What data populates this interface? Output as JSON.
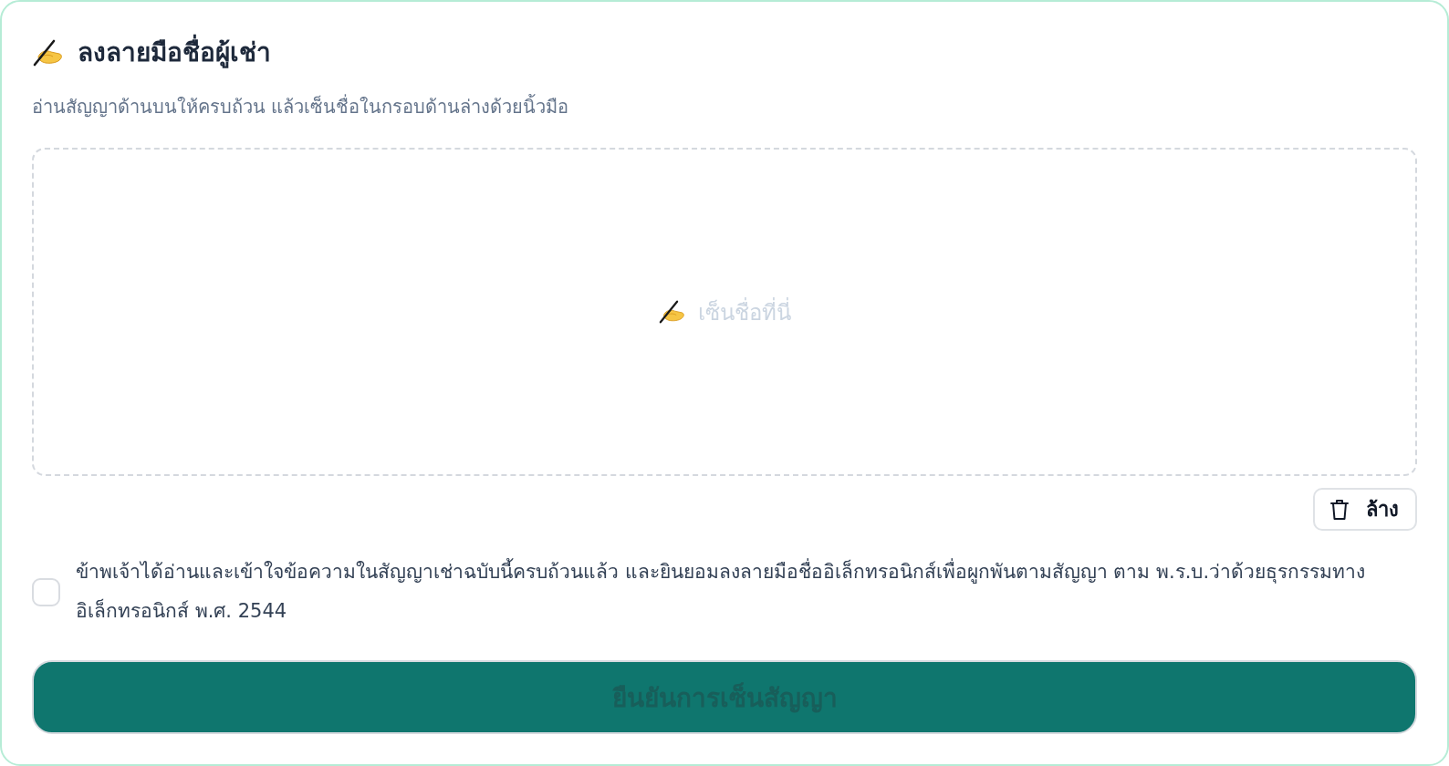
{
  "header": {
    "title": "ลงลายมือชื่อผู้เช่า",
    "subtitle": "อ่านสัญญาด้านบนให้ครบถ้วน แล้วเซ็นชื่อในกรอบด้านล่างด้วยนิ้วมือ"
  },
  "signature_pad": {
    "placeholder": "เซ็นชื่อที่นี่"
  },
  "clear_button": {
    "label": "ล้าง"
  },
  "consent": {
    "checked": false,
    "text": "ข้าพเจ้าได้อ่านและเข้าใจข้อความในสัญญาเช่าฉบับนี้ครบถ้วนแล้ว และยินยอมลงลายมือชื่ออิเล็กทรอนิกส์เพื่อผูกพันตามสัญญา ตาม พ.ร.บ.ว่าด้วยธุรกรรมทางอิเล็กทรอนิกส์ พ.ศ. 2544"
  },
  "confirm_button": {
    "label": "ยืนยันการเซ็นสัญญา",
    "disabled": true
  }
}
